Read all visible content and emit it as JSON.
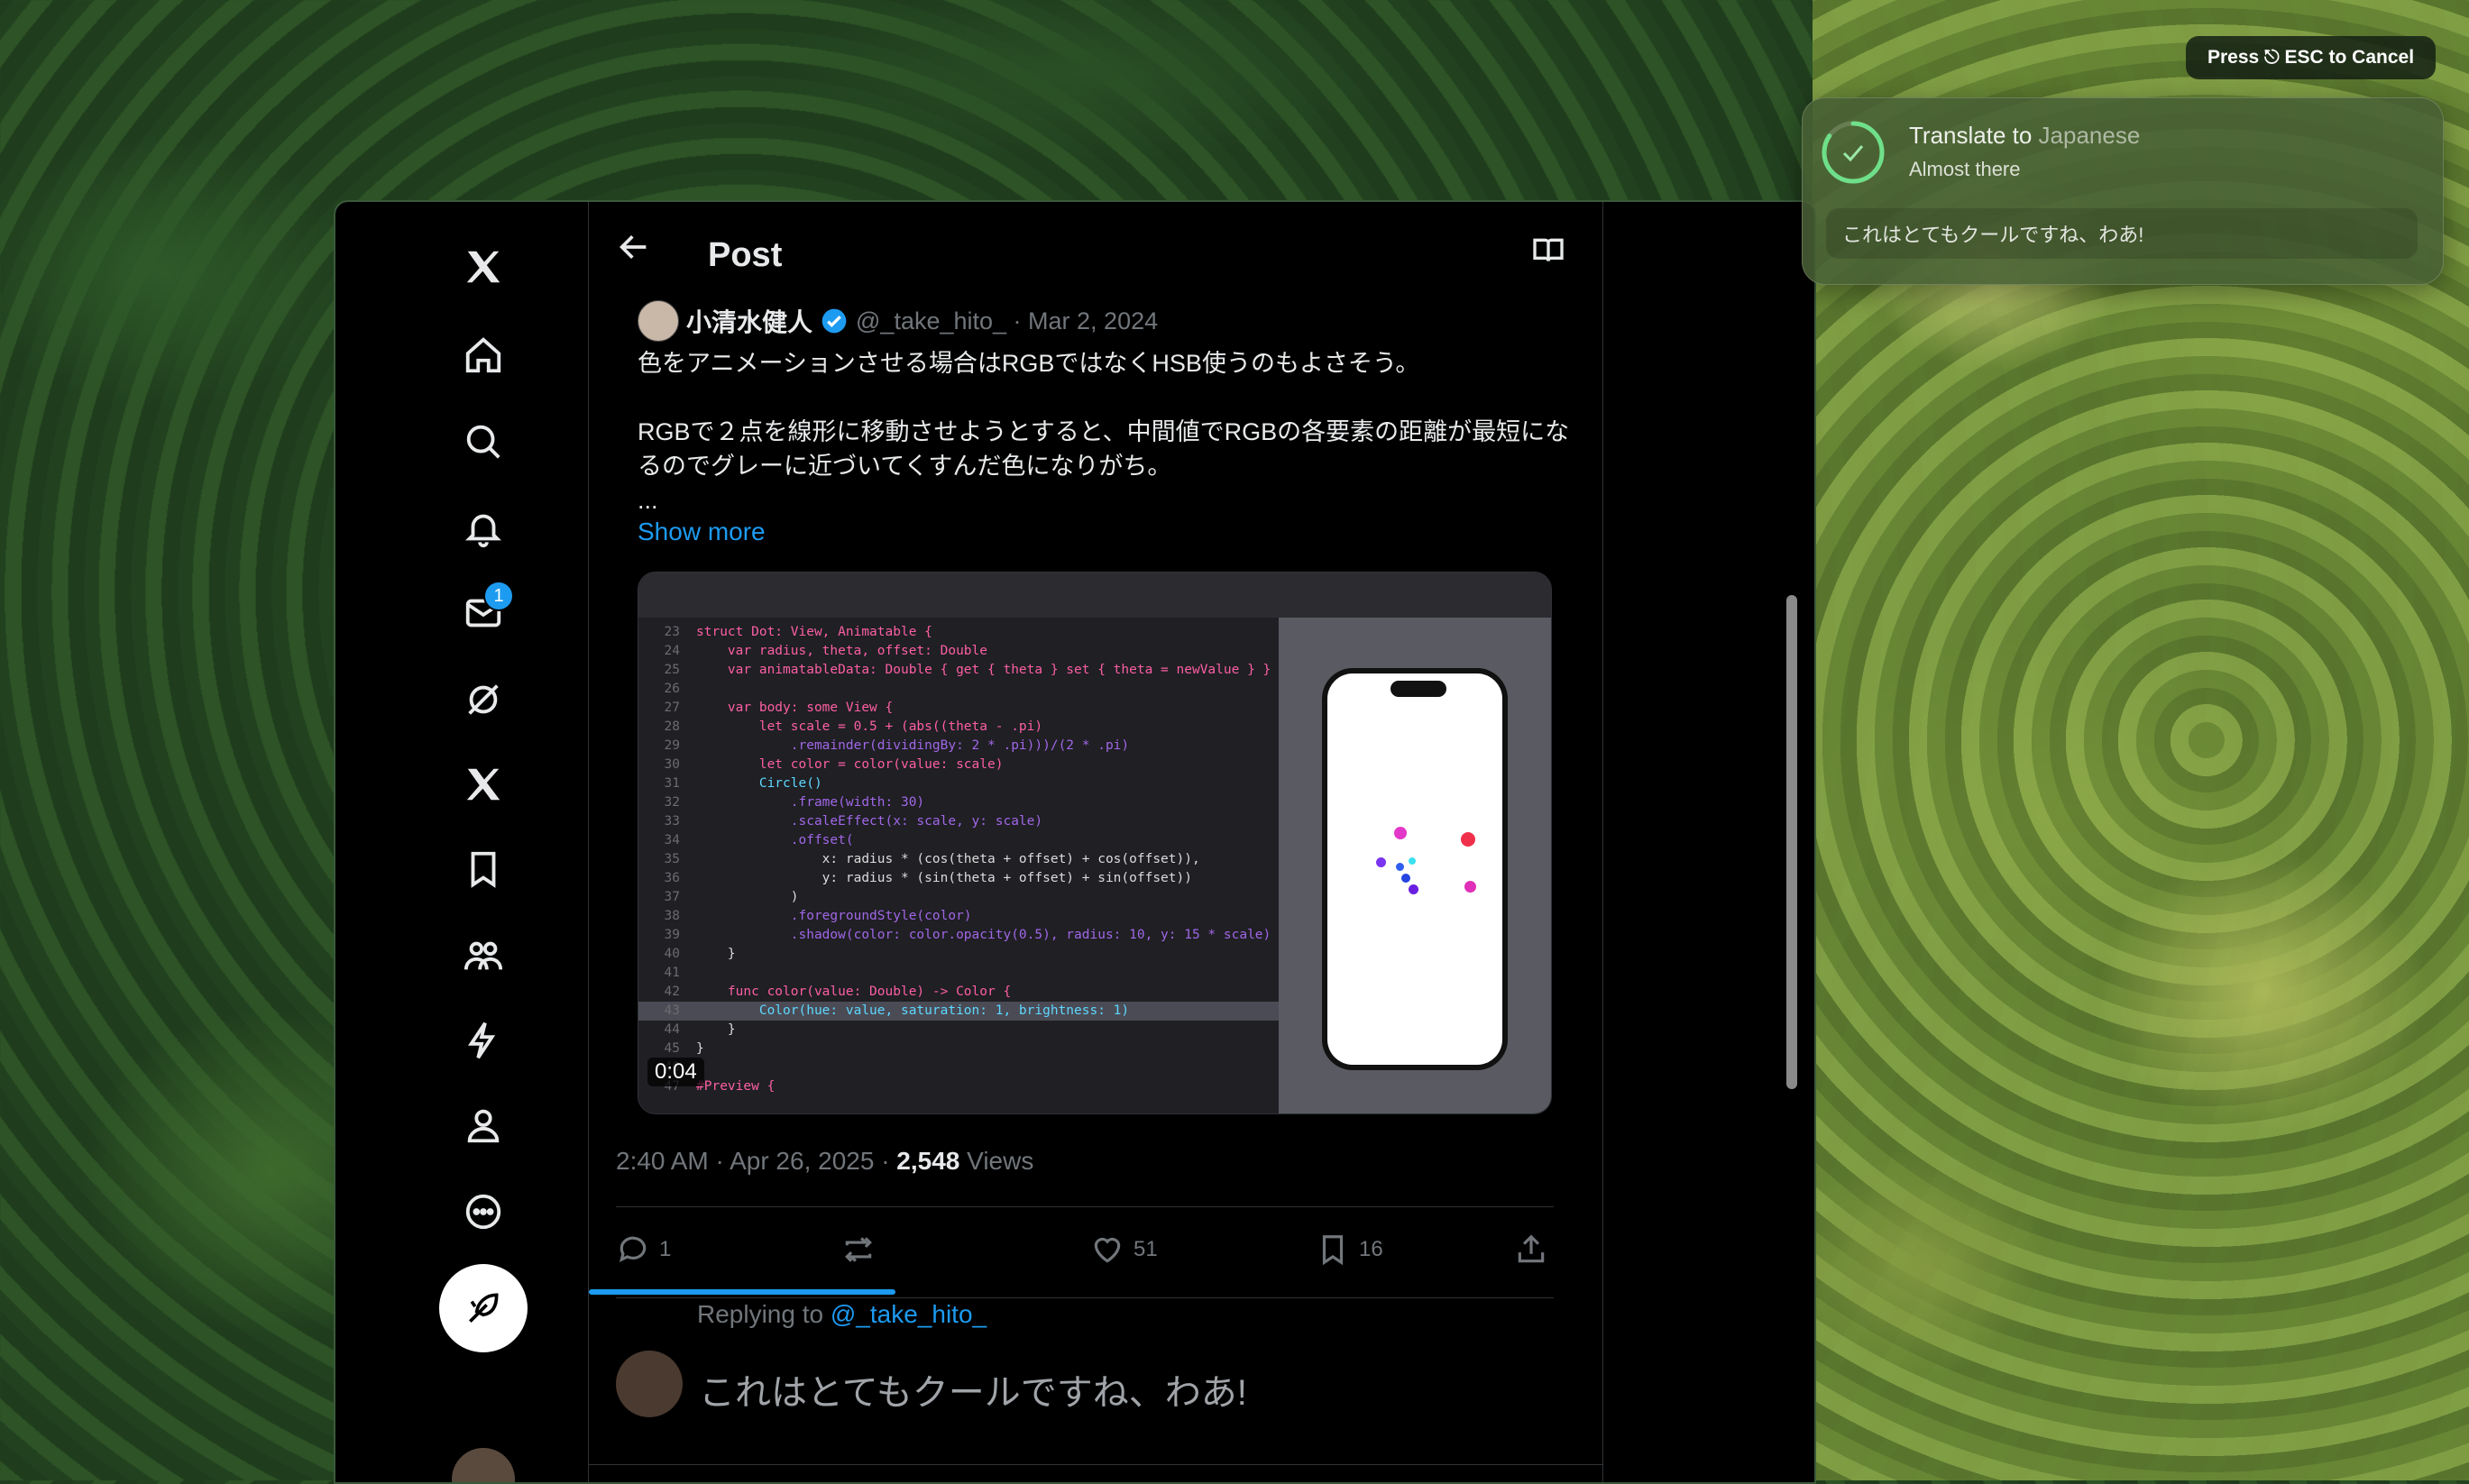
{
  "header": {
    "title": "Post"
  },
  "nav": {
    "messages_badge": "1"
  },
  "tweet": {
    "author_name": "小清水健人",
    "handle_date": "@_take_hito_ · Mar 2, 2024",
    "line1": "色をアニメーションさせる場合はRGBではなくHSB使うのもよさそう。",
    "line2": "RGBで２点を線形に移動させようとすると、中間値でRGBの各要素の距離が最短になるのでグレーに近づいてくすんだ色になりがち。",
    "line3": "...",
    "show_more": "Show more",
    "video_time": "0:04",
    "posted_at": "2:40 AM · Apr 26, 2025 · ",
    "views_count": "2,548",
    "views_label": " Views",
    "replies": "1",
    "likes": "51",
    "bookmarks": "16"
  },
  "code": {
    "lines": [
      {
        "n": "23",
        "t": "struct Dot: View, Animatable {"
      },
      {
        "n": "24",
        "t": "    var radius, theta, offset: Double"
      },
      {
        "n": "25",
        "t": "    var animatableData: Double { get { theta } set { theta = newValue } }"
      },
      {
        "n": "26",
        "t": ""
      },
      {
        "n": "27",
        "t": "    var body: some View {"
      },
      {
        "n": "28",
        "t": "        let scale = 0.5 + (abs((theta - .pi)"
      },
      {
        "n": "29",
        "t": "            .remainder(dividingBy: 2 * .pi)))/(2 * .pi)"
      },
      {
        "n": "30",
        "t": "        let color = color(value: scale)"
      },
      {
        "n": "31",
        "t": "        Circle()"
      },
      {
        "n": "32",
        "t": "            .frame(width: 30)"
      },
      {
        "n": "33",
        "t": "            .scaleEffect(x: scale, y: scale)"
      },
      {
        "n": "34",
        "t": "            .offset("
      },
      {
        "n": "35",
        "t": "                x: radius * (cos(theta + offset) + cos(offset)),"
      },
      {
        "n": "36",
        "t": "                y: radius * (sin(theta + offset) + sin(offset))"
      },
      {
        "n": "37",
        "t": "            )"
      },
      {
        "n": "38",
        "t": "            .foregroundStyle(color)"
      },
      {
        "n": "39",
        "t": "            .shadow(color: color.opacity(0.5), radius: 10, y: 15 * scale)"
      },
      {
        "n": "40",
        "t": "    }"
      },
      {
        "n": "41",
        "t": ""
      },
      {
        "n": "42",
        "t": "    func color(value: Double) -> Color {"
      },
      {
        "n": "43",
        "t": "        Color(hue: value, saturation: 1, brightness: 1)"
      },
      {
        "n": "44",
        "t": "    }"
      },
      {
        "n": "45",
        "t": "}"
      },
      {
        "n": "46",
        "t": ""
      },
      {
        "n": "47",
        "t": "#Preview {"
      }
    ]
  },
  "reply": {
    "replying_prefix": "Replying to ",
    "replying_handle": "@_take_hito_",
    "draft": "これはとてもクールですね、わあ!"
  },
  "overlay": {
    "esc_hint": "Press ⎋ ESC to Cancel",
    "task_title_dim": "Translate to ",
    "task_title_lang": "Japanese",
    "task_status": "Almost there",
    "task_result": "これはとてもクールですね、わあ!"
  },
  "colors": {
    "accent": "#1d9bf0",
    "background": "#000000",
    "toast": "#486034"
  }
}
